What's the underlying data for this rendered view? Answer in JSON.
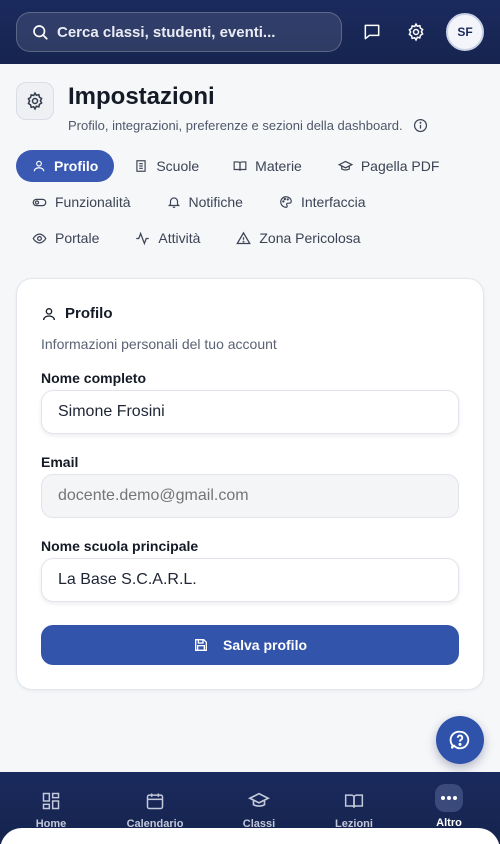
{
  "topbar": {
    "search_placeholder": "Cerca classi, studenti, eventi...",
    "avatar_initials": "SF"
  },
  "header": {
    "title": "Impostazioni",
    "subtitle": "Profilo, integrazioni, preferenze e sezioni della dashboard."
  },
  "tabs": [
    {
      "label": "Profilo",
      "icon": "user-icon",
      "active": true
    },
    {
      "label": "Scuole",
      "icon": "building-icon"
    },
    {
      "label": "Materie",
      "icon": "book-icon"
    },
    {
      "label": "Pagella PDF",
      "icon": "graduation-cap-icon"
    },
    {
      "label": "Funzionalità",
      "icon": "toggle-icon"
    },
    {
      "label": "Notifiche",
      "icon": "bell-icon"
    },
    {
      "label": "Interfaccia",
      "icon": "palette-icon"
    },
    {
      "label": "Portale",
      "icon": "eye-icon"
    },
    {
      "label": "Attività",
      "icon": "activity-icon"
    },
    {
      "label": "Zona Pericolosa",
      "icon": "warning-icon"
    }
  ],
  "profile_card": {
    "title": "Profilo",
    "description": "Informazioni personali del tuo account",
    "full_name_label": "Nome completo",
    "full_name_value": "Simone Frosini",
    "email_label": "Email",
    "email_placeholder": "docente.demo@gmail.com",
    "school_label": "Nome scuola principale",
    "school_value": "La Base S.C.A.R.L.",
    "save_label": "Salva profilo"
  },
  "bottom_nav": [
    {
      "label": "Home",
      "icon": "grid-icon"
    },
    {
      "label": "Calendario",
      "icon": "calendar-icon"
    },
    {
      "label": "Classi",
      "icon": "graduation-cap-icon"
    },
    {
      "label": "Lezioni",
      "icon": "book-open-icon"
    },
    {
      "label": "Altro",
      "icon": "more-icon",
      "active": true
    }
  ],
  "colors": {
    "primary": "#3354ab",
    "topbar": "#1b2a5e"
  }
}
